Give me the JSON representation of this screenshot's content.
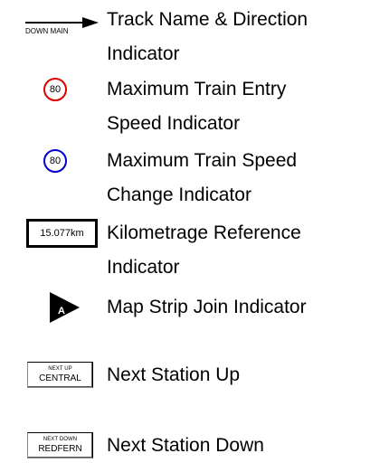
{
  "legend": [
    {
      "id": "track",
      "symbol_text": "DOWN MAIN",
      "lines": [
        "Track Name & Direction",
        "Indicator"
      ]
    },
    {
      "id": "entry_speed",
      "symbol_text": "80",
      "ring_color": "#e00000",
      "lines": [
        "Maximum Train Entry",
        "Speed Indicator"
      ]
    },
    {
      "id": "speed_change",
      "symbol_text": "80",
      "ring_color": "#0000cc",
      "lines": [
        "Maximum Train Speed",
        "Change Indicator"
      ]
    },
    {
      "id": "km",
      "symbol_text": "15.077km",
      "lines": [
        "Kilometrage Reference",
        "Indicator"
      ]
    },
    {
      "id": "strip_join",
      "symbol_text": "A",
      "icon": "triangle-pointer-icon",
      "lines": [
        "Map Strip Join Indicator"
      ]
    },
    {
      "id": "next_up",
      "symbol_top": "NEXT UP",
      "symbol_bottom": "CENTRAL",
      "lines": [
        "Next Station Up"
      ]
    },
    {
      "id": "next_down",
      "symbol_top": "NEXT DOWN",
      "symbol_bottom": "REDFERN",
      "lines": [
        "Next Station Down"
      ]
    }
  ]
}
